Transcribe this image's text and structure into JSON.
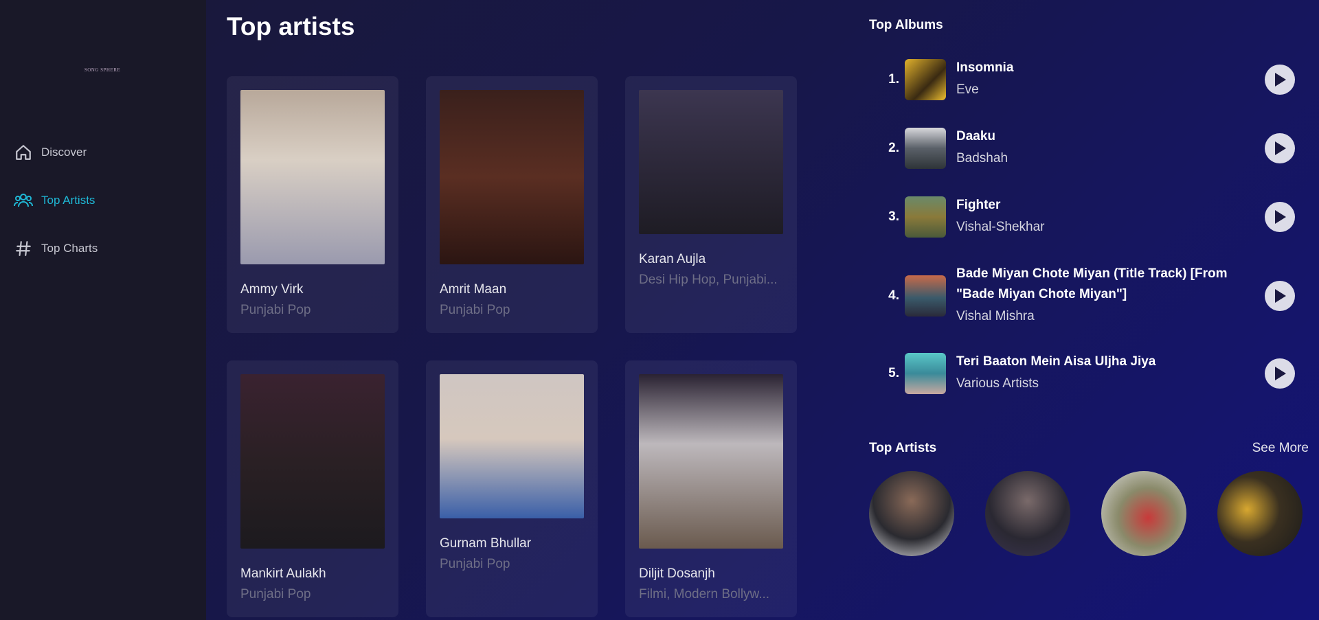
{
  "app": {
    "logo_text": "SONG SPHERE"
  },
  "sidebar": {
    "items": [
      {
        "label": "Discover",
        "icon": "home-icon",
        "active": false
      },
      {
        "label": "Top Artists",
        "icon": "users-icon",
        "active": true
      },
      {
        "label": "Top Charts",
        "icon": "hashtag-icon",
        "active": false
      }
    ]
  },
  "main": {
    "title": "Top artists",
    "artists": [
      {
        "name": "Ammy Virk",
        "genre": "Punjabi Pop"
      },
      {
        "name": "Amrit Maan",
        "genre": "Punjabi Pop"
      },
      {
        "name": "Karan Aujla",
        "genre": "Desi Hip Hop, Punjabi..."
      },
      {
        "name": "Mankirt Aulakh",
        "genre": "Punjabi Pop"
      },
      {
        "name": "Gurnam Bhullar",
        "genre": "Punjabi Pop"
      },
      {
        "name": "Diljit Dosanjh",
        "genre": "Filmi, Modern Bollyw..."
      }
    ]
  },
  "right": {
    "albums_title": "Top Albums",
    "albums": [
      {
        "rank": "1.",
        "title": "Insomnia",
        "artist": "Eve"
      },
      {
        "rank": "2.",
        "title": "Daaku",
        "artist": "Badshah"
      },
      {
        "rank": "3.",
        "title": "Fighter",
        "artist": "Vishal-Shekhar"
      },
      {
        "rank": "4.",
        "title": "Bade Miyan Chote Miyan (Title Track) [From \"Bade Miyan Chote Miyan\"]",
        "artist": "Vishal Mishra"
      },
      {
        "rank": "5.",
        "title": "Teri Baaton Mein Aisa Uljha Jiya",
        "artist": "Various Artists"
      }
    ],
    "artists_title": "Top Artists",
    "see_more": "See More"
  },
  "colors": {
    "accent": "#1fb8d6",
    "sidebar_bg": "#191828",
    "play_button": "#dcdce8"
  }
}
